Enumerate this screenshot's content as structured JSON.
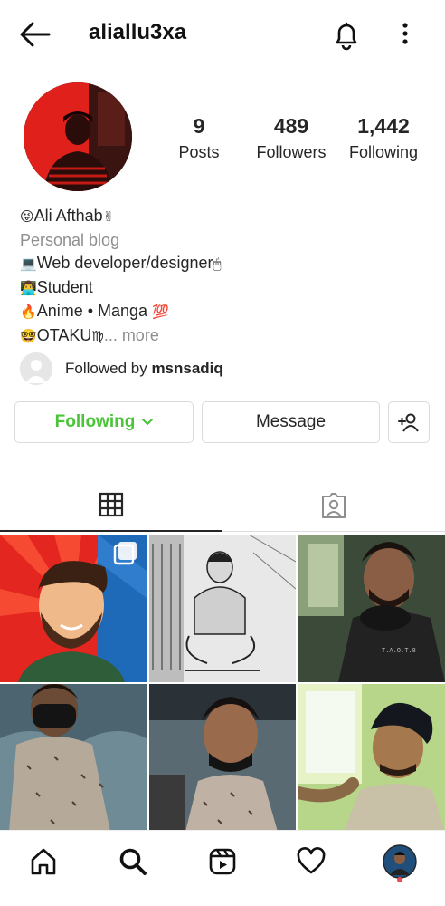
{
  "header": {
    "username": "aliallu3xa",
    "icons": [
      "back-arrow-icon",
      "bell-icon",
      "more-vertical-icon"
    ]
  },
  "stats": {
    "posts": {
      "value": "9",
      "label": "Posts"
    },
    "followers": {
      "value": "489",
      "label": "Followers"
    },
    "following": {
      "value": "1,442",
      "label": "Following"
    }
  },
  "bio": {
    "name": "Ali Afthab",
    "category": "Personal blog",
    "lines": [
      "Web developer/designer",
      "Student",
      "Anime • Manga",
      "OTAKU"
    ],
    "more": "... more",
    "emojis": {
      "name_prefix": "😜",
      "name_suffix": "✌",
      "line1_prefix": "💻",
      "line1_suffix": "🖱",
      "line2_prefix": "👨‍💻",
      "line3_prefix": "🔥",
      "line3_suffix": "💯",
      "line4_prefix": "🤓",
      "line4_suffix": "♍"
    }
  },
  "followed_by": {
    "prefix": "Followed by ",
    "user": "msnsadiq"
  },
  "actions": {
    "following_label": "Following",
    "message_label": "Message",
    "following_color": "#4bc43a"
  },
  "tabs": [
    {
      "name": "grid",
      "icon": "grid-icon",
      "active": true
    },
    {
      "name": "tagged",
      "icon": "tagged-person-icon",
      "active": false
    }
  ],
  "posts": [
    {
      "type": "carousel",
      "icon": "multiple-posts-icon"
    },
    {
      "type": "photo"
    },
    {
      "type": "photo"
    },
    {
      "type": "photo"
    },
    {
      "type": "photo"
    },
    {
      "type": "photo"
    }
  ],
  "bottom_nav": [
    "home-icon",
    "search-icon",
    "reels-icon",
    "heart-icon",
    "profile-avatar"
  ],
  "colors": {
    "accent_following": "#4bc43a",
    "notification_dot": "#ed4956",
    "avatar_red": "#e0201a"
  }
}
